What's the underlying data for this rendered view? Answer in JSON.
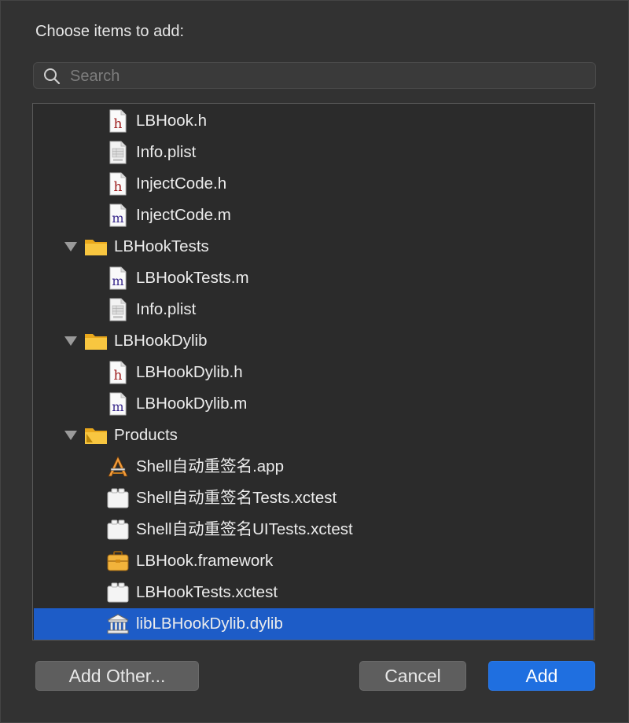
{
  "dialog": {
    "prompt": "Choose items to add:",
    "search_placeholder": "Search",
    "buttons": {
      "add_other": "Add Other...",
      "cancel": "Cancel",
      "add": "Add"
    }
  },
  "tree": [
    {
      "label": "LBHook.h",
      "icon": "header-file-icon",
      "depth": 2,
      "folder": false,
      "selected": false
    },
    {
      "label": "Info.plist",
      "icon": "plist-file-icon",
      "depth": 2,
      "folder": false,
      "selected": false
    },
    {
      "label": "InjectCode.h",
      "icon": "header-file-icon",
      "depth": 2,
      "folder": false,
      "selected": false
    },
    {
      "label": "InjectCode.m",
      "icon": "objc-source-file-icon",
      "depth": 2,
      "folder": false,
      "selected": false
    },
    {
      "label": "LBHookTests",
      "icon": "folder-icon",
      "depth": 1,
      "folder": true,
      "selected": false
    },
    {
      "label": "LBHookTests.m",
      "icon": "objc-source-file-icon",
      "depth": 2,
      "folder": false,
      "selected": false
    },
    {
      "label": "Info.plist",
      "icon": "plist-file-icon",
      "depth": 2,
      "folder": false,
      "selected": false
    },
    {
      "label": "LBHookDylib",
      "icon": "folder-icon",
      "depth": 1,
      "folder": true,
      "selected": false
    },
    {
      "label": "LBHookDylib.h",
      "icon": "header-file-icon",
      "depth": 2,
      "folder": false,
      "selected": false
    },
    {
      "label": "LBHookDylib.m",
      "icon": "objc-source-file-icon",
      "depth": 2,
      "folder": false,
      "selected": false
    },
    {
      "label": "Products",
      "icon": "products-folder-icon",
      "depth": 1,
      "folder": true,
      "selected": false
    },
    {
      "label": "Shell自动重签名.app",
      "icon": "app-icon",
      "depth": 2,
      "folder": false,
      "selected": false
    },
    {
      "label": "Shell自动重签名Tests.xctest",
      "icon": "xctest-bundle-icon",
      "depth": 2,
      "folder": false,
      "selected": false
    },
    {
      "label": "Shell自动重签名UITests.xctest",
      "icon": "xctest-bundle-icon",
      "depth": 2,
      "folder": false,
      "selected": false
    },
    {
      "label": "LBHook.framework",
      "icon": "framework-icon",
      "depth": 2,
      "folder": false,
      "selected": false
    },
    {
      "label": "LBHookTests.xctest",
      "icon": "xctest-bundle-icon",
      "depth": 2,
      "folder": false,
      "selected": false
    },
    {
      "label": "libLBHookDylib.dylib",
      "icon": "dylib-icon",
      "depth": 2,
      "folder": false,
      "selected": true
    }
  ]
}
